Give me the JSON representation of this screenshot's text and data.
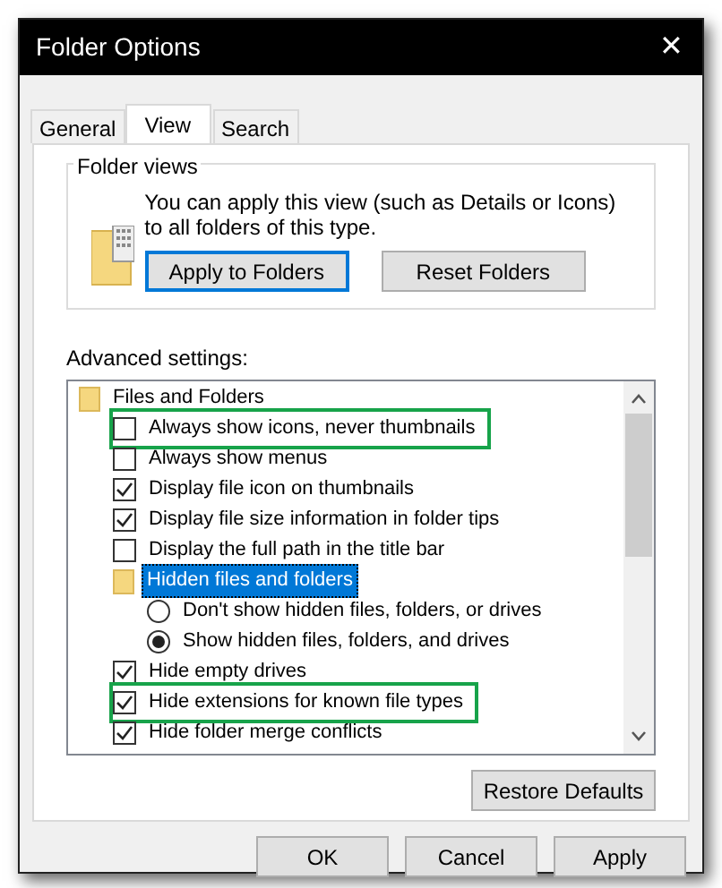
{
  "window": {
    "title": "Folder Options",
    "close": "✕"
  },
  "tabs": [
    {
      "label": "General",
      "selected": false
    },
    {
      "label": "View",
      "selected": true
    },
    {
      "label": "Search",
      "selected": false
    }
  ],
  "folder_views": {
    "legend": "Folder views",
    "description": "You can apply this view (such as Details or Icons) to all folders of this type.",
    "buttons": [
      {
        "label": "Apply to Folders",
        "focused": true
      },
      {
        "label": "Reset Folders",
        "focused": false
      }
    ]
  },
  "advanced_settings": {
    "label": "Advanced settings:",
    "items": [
      {
        "kind": "folder",
        "label": "Files and Folders",
        "selected": false,
        "highlighted": false,
        "children": [
          {
            "kind": "checkbox",
            "label": "Always show icons, never thumbnails",
            "checked": false,
            "selected": false,
            "highlighted": true
          },
          {
            "kind": "checkbox",
            "label": "Always show menus",
            "checked": false,
            "selected": false,
            "highlighted": false
          },
          {
            "kind": "checkbox",
            "label": "Display file icon on thumbnails",
            "checked": true,
            "selected": false,
            "highlighted": false
          },
          {
            "kind": "checkbox",
            "label": "Display file size information in folder tips",
            "checked": true,
            "selected": false,
            "highlighted": false
          },
          {
            "kind": "checkbox",
            "label": "Display the full path in the title bar",
            "checked": false,
            "selected": false,
            "highlighted": false
          },
          {
            "kind": "folder",
            "label": "Hidden files and folders",
            "selected": true,
            "highlighted": false,
            "children": [
              {
                "kind": "radio",
                "label": "Don't show hidden files, folders, or drives",
                "checked": false,
                "selected": false,
                "highlighted": false
              },
              {
                "kind": "radio",
                "label": "Show hidden files, folders, and drives",
                "checked": true,
                "selected": false,
                "highlighted": false
              }
            ]
          },
          {
            "kind": "checkbox",
            "label": "Hide empty drives",
            "checked": true,
            "selected": false,
            "highlighted": false
          },
          {
            "kind": "checkbox",
            "label": "Hide extensions for known file types",
            "checked": true,
            "selected": false,
            "highlighted": true
          },
          {
            "kind": "checkbox",
            "label": "Hide folder merge conflicts",
            "checked": true,
            "selected": false,
            "highlighted": false
          }
        ]
      }
    ]
  },
  "restore_button": "Restore Defaults",
  "buttons": [
    {
      "label": "OK"
    },
    {
      "label": "Cancel"
    },
    {
      "label": "Apply"
    }
  ]
}
